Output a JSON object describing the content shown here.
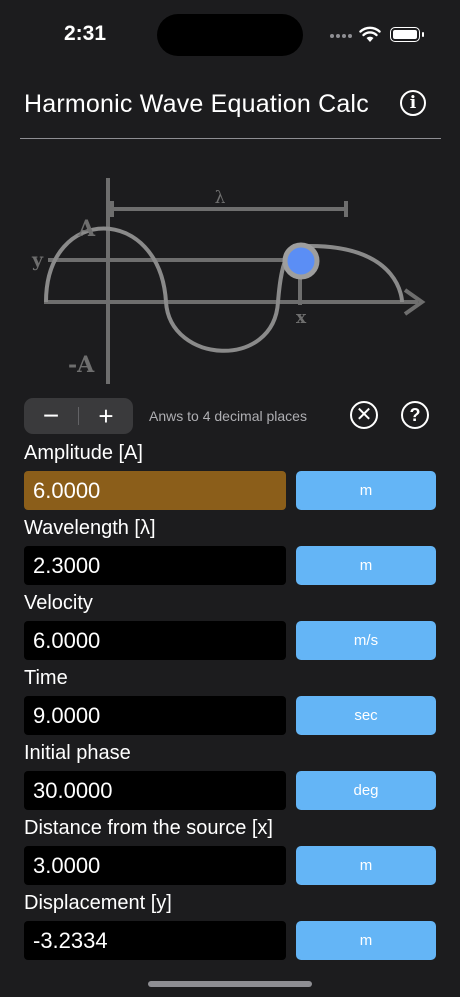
{
  "status_bar": {
    "time": "2:31"
  },
  "header": {
    "title": "Harmonic Wave Equation Calc",
    "info_icon": "info-icon"
  },
  "diagram": {
    "labels": {
      "lambda": "λ",
      "amplitude": "A",
      "neg_amplitude": "-A",
      "y": "y",
      "x": "x"
    },
    "colors": {
      "lines": "#6e6e6e",
      "wave": "#8a8a8a",
      "point": "#5b8ef5"
    }
  },
  "toolbar": {
    "minus": "−",
    "plus": "+",
    "decimals_text": "Anws to 4 decimal places",
    "clear_icon": "clear-circle-icon",
    "help_icon": "help-circle-icon"
  },
  "fields": [
    {
      "label": "Amplitude [A]",
      "value": "6.0000",
      "unit": "m",
      "active": true
    },
    {
      "label": "Wavelength [λ]",
      "value": "2.3000",
      "unit": "m",
      "active": false
    },
    {
      "label": "Velocity",
      "value": "6.0000",
      "unit": "m/s",
      "active": false
    },
    {
      "label": "Time",
      "value": "9.0000",
      "unit": "sec",
      "active": false
    },
    {
      "label": "Initial phase",
      "value": "30.0000",
      "unit": "deg",
      "active": false
    },
    {
      "label": "Distance from the source [x]",
      "value": "3.0000",
      "unit": "m",
      "active": false
    },
    {
      "label": "Displacement [y]",
      "value": "-3.2334",
      "unit": "m",
      "active": false
    }
  ],
  "colors": {
    "background": "#1c1c1e",
    "active_field": "#8b5e1a",
    "unit_button": "#64b5f6"
  }
}
